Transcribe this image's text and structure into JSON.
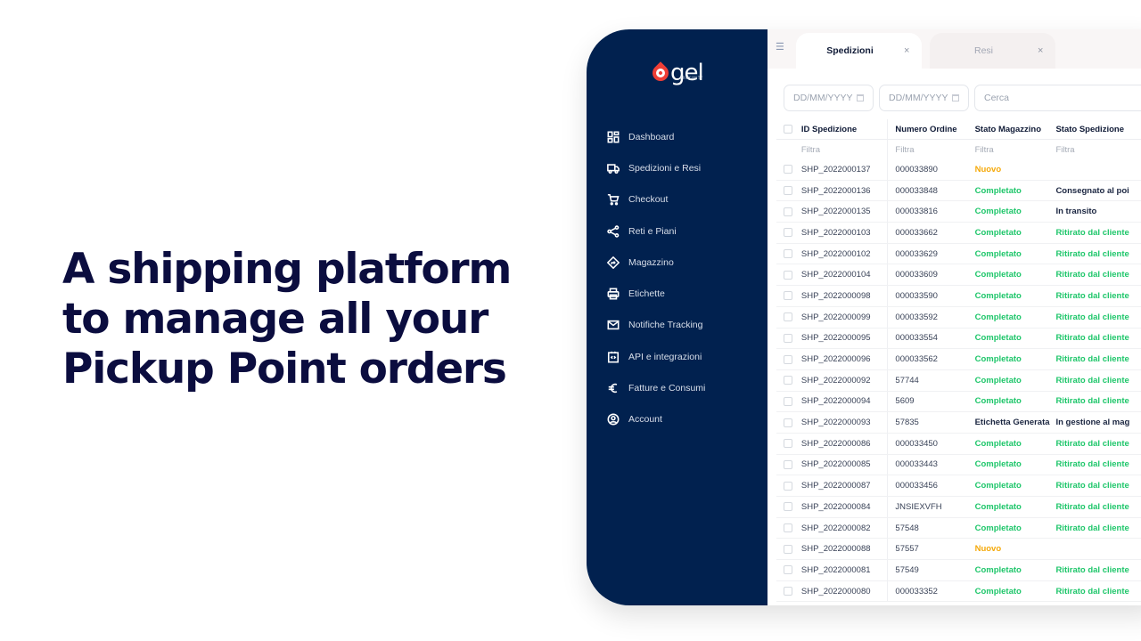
{
  "headline": [
    "A shipping platform",
    "to manage all your",
    "Pickup Point orders"
  ],
  "colors": {
    "sidebar_bg": "#01214f",
    "headline": "#0b0d3f",
    "status_completed": "#1ec66a",
    "status_new": "#f5a90a",
    "logo_accent": "#ef3e36"
  },
  "logo": {
    "text": "gel",
    "subtitle": "PROXIMITY"
  },
  "sidebar": {
    "items": [
      {
        "label": "Dashboard",
        "icon": "dashboard-icon"
      },
      {
        "label": "Spedizioni e Resi",
        "icon": "truck-icon"
      },
      {
        "label": "Checkout",
        "icon": "cart-icon"
      },
      {
        "label": "Reti e Piani",
        "icon": "share-icon"
      },
      {
        "label": "Magazzino",
        "icon": "directions-icon"
      },
      {
        "label": "Etichette",
        "icon": "printer-icon"
      },
      {
        "label": "Notifiche Tracking",
        "icon": "mail-icon"
      },
      {
        "label": "API e integrazioni",
        "icon": "code-icon"
      },
      {
        "label": "Fatture e Consumi",
        "icon": "euro-icon"
      },
      {
        "label": "Account",
        "icon": "account-icon"
      }
    ]
  },
  "tabs": [
    {
      "label": "Spedizioni",
      "close": "×",
      "active": true
    },
    {
      "label": "Resi",
      "close": "×",
      "active": false
    }
  ],
  "filters": {
    "date_from_placeholder": "DD/MM/YYYY",
    "date_to_placeholder": "DD/MM/YYYY",
    "search_placeholder": "Cerca"
  },
  "table": {
    "columns": [
      "ID Spedizione",
      "Numero Ordine",
      "Stato Magazzino",
      "Stato Spedizione"
    ],
    "filter_label": "Filtra",
    "rows": [
      {
        "id": "SHP_2022000137",
        "order": "000033890",
        "warehouse": "Nuovo",
        "wh_status": "orange",
        "shipping": "",
        "sh_status": "dark"
      },
      {
        "id": "SHP_2022000136",
        "order": "000033848",
        "warehouse": "Completato",
        "wh_status": "green",
        "shipping": "Consegnato al poi",
        "sh_status": "dark"
      },
      {
        "id": "SHP_2022000135",
        "order": "000033816",
        "warehouse": "Completato",
        "wh_status": "green",
        "shipping": "In transito",
        "sh_status": "dark"
      },
      {
        "id": "SHP_2022000103",
        "order": "000033662",
        "warehouse": "Completato",
        "wh_status": "green",
        "shipping": "Ritirato dal cliente",
        "sh_status": "green"
      },
      {
        "id": "SHP_2022000102",
        "order": "000033629",
        "warehouse": "Completato",
        "wh_status": "green",
        "shipping": "Ritirato dal cliente",
        "sh_status": "green"
      },
      {
        "id": "SHP_2022000104",
        "order": "000033609",
        "warehouse": "Completato",
        "wh_status": "green",
        "shipping": "Ritirato dal cliente",
        "sh_status": "green"
      },
      {
        "id": "SHP_2022000098",
        "order": "000033590",
        "warehouse": "Completato",
        "wh_status": "green",
        "shipping": "Ritirato dal cliente",
        "sh_status": "green"
      },
      {
        "id": "SHP_2022000099",
        "order": "000033592",
        "warehouse": "Completato",
        "wh_status": "green",
        "shipping": "Ritirato dal cliente",
        "sh_status": "green"
      },
      {
        "id": "SHP_2022000095",
        "order": "000033554",
        "warehouse": "Completato",
        "wh_status": "green",
        "shipping": "Ritirato dal cliente",
        "sh_status": "green"
      },
      {
        "id": "SHP_2022000096",
        "order": "000033562",
        "warehouse": "Completato",
        "wh_status": "green",
        "shipping": "Ritirato dal cliente",
        "sh_status": "green"
      },
      {
        "id": "SHP_2022000092",
        "order": "57744",
        "warehouse": "Completato",
        "wh_status": "green",
        "shipping": "Ritirato dal cliente",
        "sh_status": "green"
      },
      {
        "id": "SHP_2022000094",
        "order": "5609",
        "warehouse": "Completato",
        "wh_status": "green",
        "shipping": "Ritirato dal cliente",
        "sh_status": "green"
      },
      {
        "id": "SHP_2022000093",
        "order": "57835",
        "warehouse": "Etichetta Generata",
        "wh_status": "dark",
        "shipping": "In gestione al mag",
        "sh_status": "dark"
      },
      {
        "id": "SHP_2022000086",
        "order": "000033450",
        "warehouse": "Completato",
        "wh_status": "green",
        "shipping": "Ritirato dal cliente",
        "sh_status": "green"
      },
      {
        "id": "SHP_2022000085",
        "order": "000033443",
        "warehouse": "Completato",
        "wh_status": "green",
        "shipping": "Ritirato dal cliente",
        "sh_status": "green"
      },
      {
        "id": "SHP_2022000087",
        "order": "000033456",
        "warehouse": "Completato",
        "wh_status": "green",
        "shipping": "Ritirato dal cliente",
        "sh_status": "green"
      },
      {
        "id": "SHP_2022000084",
        "order": "JNSIEXVFH",
        "warehouse": "Completato",
        "wh_status": "green",
        "shipping": "Ritirato dal cliente",
        "sh_status": "green"
      },
      {
        "id": "SHP_2022000082",
        "order": "57548",
        "warehouse": "Completato",
        "wh_status": "green",
        "shipping": "Ritirato dal cliente",
        "sh_status": "green"
      },
      {
        "id": "SHP_2022000088",
        "order": "57557",
        "warehouse": "Nuovo",
        "wh_status": "orange",
        "shipping": "",
        "sh_status": "dark"
      },
      {
        "id": "SHP_2022000081",
        "order": "57549",
        "warehouse": "Completato",
        "wh_status": "green",
        "shipping": "Ritirato dal cliente",
        "sh_status": "green"
      },
      {
        "id": "SHP_2022000080",
        "order": "000033352",
        "warehouse": "Completato",
        "wh_status": "green",
        "shipping": "Ritirato dal cliente",
        "sh_status": "green"
      }
    ]
  }
}
